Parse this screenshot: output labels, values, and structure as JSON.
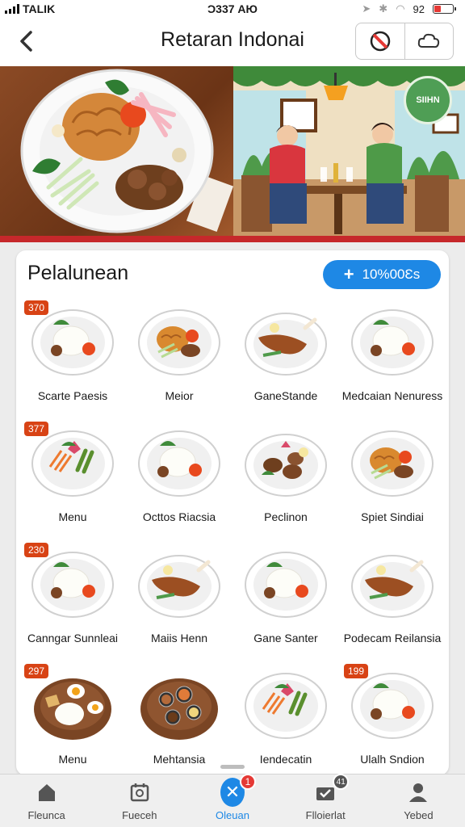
{
  "status_bar": {
    "carrier": "TALIK",
    "time": "Ͻ337 AЮ",
    "battery_text": "92",
    "battery_level": 0.35
  },
  "header": {
    "title": "Retaran Indonai",
    "back_icon": "chevron-left-icon",
    "action_icons": [
      "no-entry-icon",
      "cloud-icon"
    ]
  },
  "hero": {
    "logo_text": "SIIHN",
    "colors": {
      "stripe": "#c6282b",
      "logo": "#4f9e55"
    }
  },
  "menu": {
    "title": "Pelalunean",
    "add_button_label": "10%00Ɛs",
    "items": [
      {
        "name": "Scarte Paesis",
        "price": "370",
        "dish": "rice-plate"
      },
      {
        "name": "Meior",
        "price": "",
        "dish": "noodle-plate"
      },
      {
        "name": "GaneStande",
        "price": "",
        "dish": "chicken-plate"
      },
      {
        "name": "Medcaian Nenuress",
        "price": "",
        "dish": "rice-plate"
      },
      {
        "name": "Menu",
        "price": "377",
        "dish": "salad-plate"
      },
      {
        "name": "Octtos Riacsia",
        "price": "",
        "dish": "rice-plate"
      },
      {
        "name": "Peclinon",
        "price": "",
        "dish": "meat-plate"
      },
      {
        "name": "Spiet Sindiai",
        "price": "",
        "dish": "noodle-plate"
      },
      {
        "name": "Canngar Sunnleai",
        "price": "230",
        "dish": "rice-plate"
      },
      {
        "name": "Maiis Henn",
        "price": "",
        "dish": "chicken-plate"
      },
      {
        "name": "Gane Santer",
        "price": "",
        "dish": "rice-plate"
      },
      {
        "name": "Podecam Reilansia",
        "price": "",
        "dish": "chicken-plate"
      },
      {
        "name": "Menu",
        "price": "297",
        "dish": "egg-bowl"
      },
      {
        "name": "Mehtansia",
        "price": "",
        "dish": "sauce-bowl"
      },
      {
        "name": "Iendecatin",
        "price": "",
        "dish": "salad-plate"
      },
      {
        "name": "Ulalh Sndion",
        "price": "199",
        "dish": "rice-plate"
      }
    ]
  },
  "tabbar": {
    "tabs": [
      {
        "label": "Fleunca",
        "icon": "home-icon"
      },
      {
        "label": "Fueceh",
        "icon": "calendar-icon"
      },
      {
        "label": "Oleuan",
        "icon": "close-icon",
        "badge": "1"
      },
      {
        "label": "Flloierlat",
        "icon": "inbox-icon",
        "badge": "41"
      },
      {
        "label": "Yebed",
        "icon": "user-icon"
      }
    ],
    "accent": "#1e88e5"
  }
}
